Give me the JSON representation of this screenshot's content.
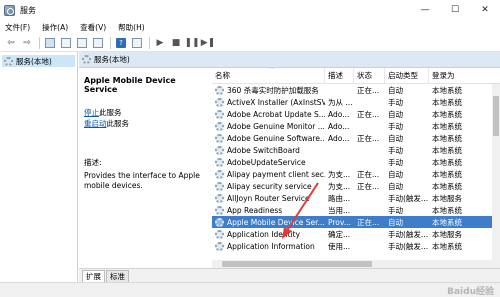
{
  "window": {
    "title": "服务",
    "minimize": "—",
    "maximize": "☐",
    "close": "✕"
  },
  "menu": [
    "文件(F)",
    "操作(A)",
    "查看(V)",
    "帮助(H)"
  ],
  "toolbar": {
    "back": "⇦",
    "forward": "⇨",
    "play": "▶",
    "stop": "■",
    "pause": "❚❚",
    "restart": "▶❚",
    "help": "?"
  },
  "tree": {
    "item": "服务(本地)"
  },
  "header": {
    "label": "服务(本地)"
  },
  "extended": {
    "service_name": "Apple Mobile Device Service",
    "stop_link": "停止",
    "stop_rest": "此服务",
    "restart_link": "重启动",
    "restart_rest": "此服务",
    "desc_label": "描述:",
    "desc_text": "Provides the interface to Apple mobile devices."
  },
  "columns": [
    "名称",
    "描述",
    "状态",
    "启动类型",
    "登录为"
  ],
  "rows": [
    {
      "name": "360 杀毒实时防护加载服务",
      "desc": "",
      "status": "正在...",
      "start": "自动",
      "logon": "本地系统",
      "selected": false
    },
    {
      "name": "ActiveX Installer (AxInstSV)",
      "desc": "为从 ...",
      "status": "",
      "start": "手动",
      "logon": "本地系统",
      "selected": false
    },
    {
      "name": "Adobe Acrobat Update S...",
      "desc": "Ado...",
      "status": "正在...",
      "start": "自动",
      "logon": "本地系统",
      "selected": false
    },
    {
      "name": "Adobe Genuine Monitor ...",
      "desc": "Ado...",
      "status": "",
      "start": "手动",
      "logon": "本地系统",
      "selected": false
    },
    {
      "name": "Adobe Genuine Software...",
      "desc": "Ado...",
      "status": "正在...",
      "start": "自动",
      "logon": "本地系统",
      "selected": false
    },
    {
      "name": "Adobe SwitchBoard",
      "desc": "",
      "status": "",
      "start": "手动",
      "logon": "本地系统",
      "selected": false
    },
    {
      "name": "AdobeUpdateService",
      "desc": "",
      "status": "",
      "start": "手动",
      "logon": "本地系统",
      "selected": false
    },
    {
      "name": "Alipay payment client sec...",
      "desc": "为支...",
      "status": "正在...",
      "start": "自动",
      "logon": "本地系统",
      "selected": false
    },
    {
      "name": "Alipay security service",
      "desc": "为支...",
      "status": "正在...",
      "start": "自动",
      "logon": "本地系统",
      "selected": false
    },
    {
      "name": "AllJoyn Router Service",
      "desc": "路由...",
      "status": "",
      "start": "手动(触发...",
      "logon": "本地服务",
      "selected": false
    },
    {
      "name": "App Readiness",
      "desc": "当用...",
      "status": "",
      "start": "手动",
      "logon": "本地系统",
      "selected": false
    },
    {
      "name": "Apple Mobile Device Ser...",
      "desc": "Prov...",
      "status": "正在...",
      "start": "自动",
      "logon": "本地系统",
      "selected": true
    },
    {
      "name": "Application Identity",
      "desc": "确定...",
      "status": "",
      "start": "手动(触发...",
      "logon": "本地服务",
      "selected": false
    },
    {
      "name": "Application Information",
      "desc": "使用...",
      "status": "",
      "start": "手动(触发...",
      "logon": "本地系统",
      "selected": false
    }
  ],
  "bottom_tabs": [
    "扩展",
    "标准"
  ],
  "watermark": "Baidu经验"
}
